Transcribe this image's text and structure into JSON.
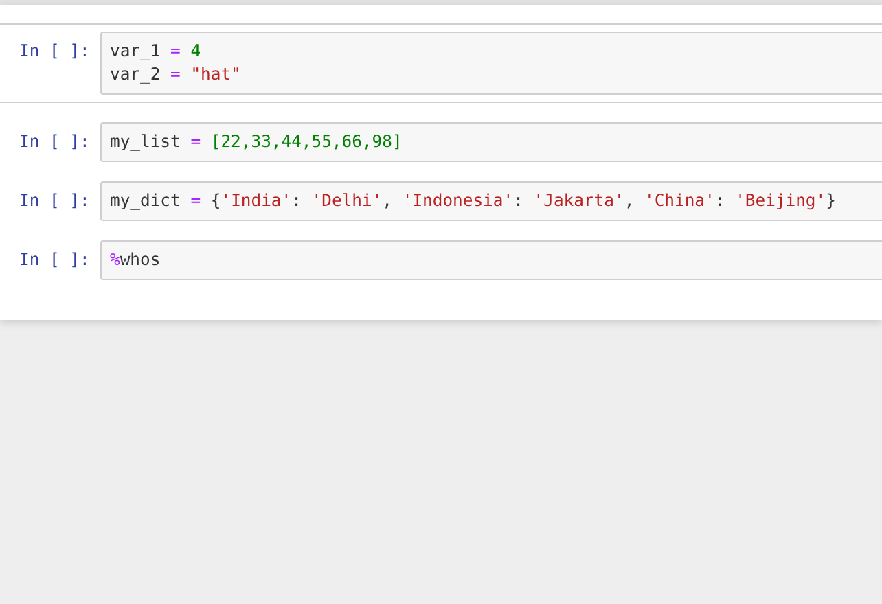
{
  "cells": [
    {
      "prompt": "In [ ]:",
      "lines": [
        [
          {
            "text": "var_1 ",
            "kind": "name"
          },
          {
            "text": "=",
            "kind": "operator"
          },
          {
            "text": " 4",
            "kind": "number"
          }
        ],
        [
          {
            "text": "var_2 ",
            "kind": "name"
          },
          {
            "text": "=",
            "kind": "operator"
          },
          {
            "text": " \"hat\"",
            "kind": "string"
          }
        ]
      ]
    },
    {
      "prompt": "In [ ]:",
      "lines": [
        [
          {
            "text": "my_list ",
            "kind": "name"
          },
          {
            "text": "=",
            "kind": "operator"
          },
          {
            "text": " [22,33,44,55,66,98]",
            "kind": "number"
          }
        ]
      ]
    },
    {
      "prompt": "In [ ]:",
      "lines": [
        [
          {
            "text": "my_dict ",
            "kind": "name"
          },
          {
            "text": "=",
            "kind": "operator"
          },
          {
            "text": " {",
            "kind": "name"
          },
          {
            "text": "'India'",
            "kind": "string"
          },
          {
            "text": ": ",
            "kind": "name"
          },
          {
            "text": "'Delhi'",
            "kind": "string"
          },
          {
            "text": ", ",
            "kind": "name"
          },
          {
            "text": "'Indonesia'",
            "kind": "string"
          },
          {
            "text": ": ",
            "kind": "name"
          },
          {
            "text": "'Jakarta'",
            "kind": "string"
          },
          {
            "text": ", ",
            "kind": "name"
          },
          {
            "text": "'China'",
            "kind": "string"
          },
          {
            "text": ": ",
            "kind": "name"
          },
          {
            "text": "'Beijing'",
            "kind": "string"
          },
          {
            "text": "}",
            "kind": "name"
          }
        ]
      ]
    },
    {
      "prompt": "In [ ]:",
      "lines": [
        [
          {
            "text": "%",
            "kind": "magic"
          },
          {
            "text": "whos",
            "kind": "name"
          }
        ]
      ]
    }
  ]
}
